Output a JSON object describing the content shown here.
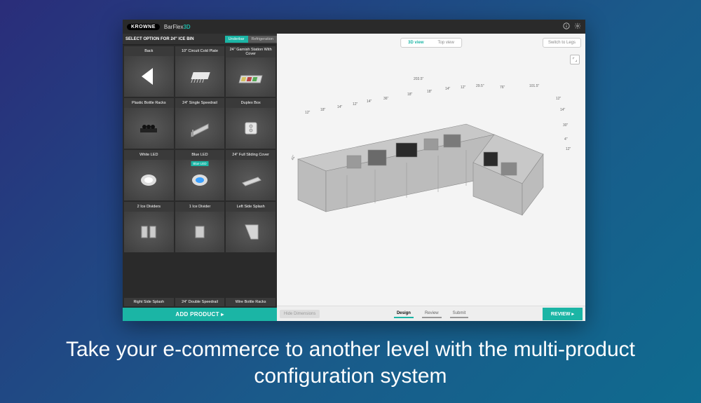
{
  "brand": "KROWNE",
  "app": {
    "name_plain": "BarFlex",
    "name_suffix": "3D"
  },
  "sidebar": {
    "title": "SELECT OPTION FOR 24\" ICE BIN",
    "tabs": {
      "active": "Underbar",
      "inactive": "Refrigeration"
    },
    "items": [
      {
        "label": "Back"
      },
      {
        "label": "10\" Circuit Cold Plate"
      },
      {
        "label": "24\" Garnish Station With Cover"
      },
      {
        "label": "Plastic Bottle Racks"
      },
      {
        "label": "24\" Single Speedrail"
      },
      {
        "label": "Duplex Box"
      },
      {
        "label": "White LED"
      },
      {
        "label": "Blue LED",
        "badge": "Blue LED"
      },
      {
        "label": "24\" Full Sliding Cover"
      },
      {
        "label": "2 Ice Dividers"
      },
      {
        "label": "1 Ice Divider"
      },
      {
        "label": "Left Side Splash"
      }
    ],
    "bottom_row": [
      "Right Side Splash",
      "24\" Double Speedrail",
      "Wire Bottle Racks"
    ],
    "add_button": "ADD PRODUCT ▸"
  },
  "viewport": {
    "tabs": {
      "active": "3D view",
      "inactive": "Top view"
    },
    "switch_button": "Switch to Legs",
    "dimensions_top": [
      "203.5\""
    ],
    "dimensions_row": [
      "12\"",
      "18\"",
      "14\"",
      "12\"",
      "14\"",
      "36\"",
      "18\"",
      "18\"",
      "14\"",
      "12\"",
      "29.5\"",
      "76\"",
      "101.5\""
    ],
    "dimensions_right": [
      "12\"",
      "14\"",
      "30\"",
      "4\"",
      "12\""
    ],
    "dimensions_left_side": "41\"",
    "footer": {
      "hide_dims": "Hide Dimensions",
      "steps": [
        "Design",
        "Review",
        "Submit"
      ],
      "active_step": 0,
      "review_button": "REVIEW ▸"
    }
  },
  "tagline": "Take your e-commerce to another level with the multi-product configuration system"
}
